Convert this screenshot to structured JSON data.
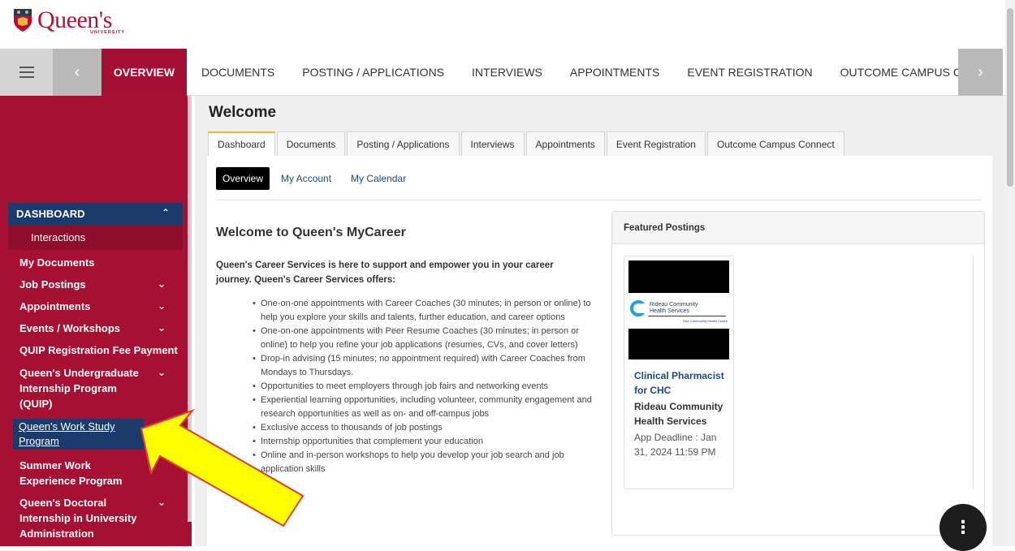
{
  "header": {
    "logo_text": "Queen's",
    "logo_subtext": "UNIVERSITY"
  },
  "navbar": {
    "overview_label": "OVERVIEW",
    "items": [
      "DOCUMENTS",
      "POSTING / APPLICATIONS",
      "INTERVIEWS",
      "APPOINTMENTS",
      "EVENT REGISTRATION",
      "OUTCOME CAMPUS CONNE"
    ]
  },
  "sidebar": {
    "dashboard_label": "DASHBOARD",
    "interactions_label": "Interactions",
    "items": [
      "My Documents",
      "Job Postings",
      "Appointments",
      "Events / Workshops",
      "QUIP Registration Fee Payment",
      "Queen's Undergraduate Internship Program (QUIP)",
      "Queen's Work Study Program",
      "Summer Work Experience Program",
      "Queen's Doctoral Internship in University Administration"
    ]
  },
  "page": {
    "title": "Welcome"
  },
  "tabs": [
    "Dashboard",
    "Documents",
    "Posting / Applications",
    "Interviews",
    "Appointments",
    "Event Registration",
    "Outcome Campus Connect"
  ],
  "subtabs": [
    "Overview",
    "My Account",
    "My Calendar"
  ],
  "intro": {
    "heading": "Welcome to Queen's MyCareer",
    "paragraph": "Queen's Career Services is here to support and empower you in your career journey. Queen's Career Services offers:",
    "bullets": [
      "One-on-one appointments with Career Coaches (30 minutes; in person or online) to help you explore your skills and talents, further education, and career options",
      "One-on-one appointments with Peer Resume Coaches (30 minutes; in person or online) to help you refine your job applications (resumes, CVs, and cover letters)",
      "Drop-in advising (15 minutes; no appointment required) with Career Coaches from Mondays to Thursdays.",
      "Opportunities to meet employers through job fairs and networking events",
      "Experiential learning opportunities, including volunteer, community engagement and research opportunities as well as on- and off-campus jobs",
      "Exclusive access to thousands of job postings",
      "Internship opportunities that complement your education",
      "Online and in-person workshops to help you develop your job search and job application skills"
    ]
  },
  "featured": {
    "heading": "Featured Postings",
    "posting": {
      "logo_line1": "Rideau Community",
      "logo_line2": "Health Services",
      "logo_tagline": "Your Community Health Centre",
      "title": "Clinical Pharmacist for CHC",
      "org": "Rideau Community Health Services",
      "deadline": "App Deadline : Jan 31, 2024 11:59 PM"
    }
  },
  "colors": {
    "brand": "#a51033",
    "navy": "#1a3b6b",
    "link": "#1a4a8a",
    "tab_accent": "#f1b434",
    "arrow": "#ffff00",
    "arrow_outline": "#e53935"
  }
}
